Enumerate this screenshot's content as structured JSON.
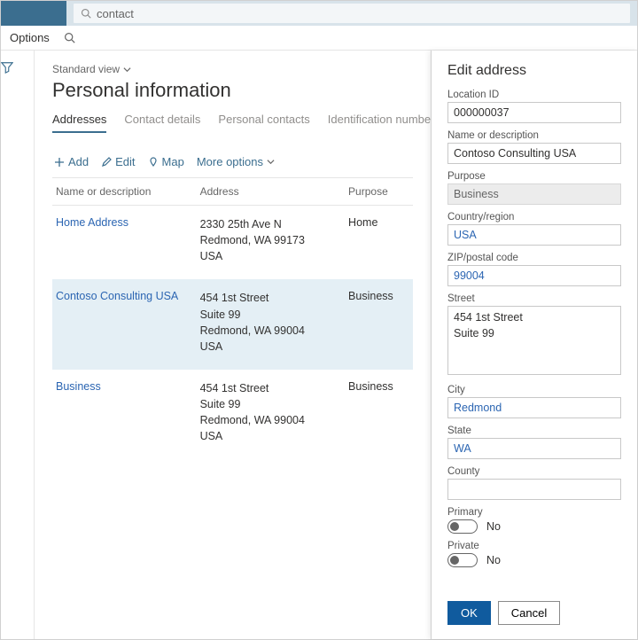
{
  "search": {
    "value": "contact"
  },
  "subbar": {
    "options": "Options"
  },
  "view_label": "Standard view",
  "page_title": "Personal information",
  "tabs": {
    "t0": "Addresses",
    "t1": "Contact details",
    "t2": "Personal contacts",
    "t3": "Identification numbers"
  },
  "toolbar": {
    "add": "Add",
    "edit": "Edit",
    "map": "Map",
    "more": "More options"
  },
  "grid": {
    "h_name": "Name or description",
    "h_addr": "Address",
    "h_purpose": "Purpose",
    "r0": {
      "name": "Home Address",
      "a1": "2330 25th Ave N",
      "a2": "Redmond, WA 99173",
      "a3": "USA",
      "purpose": "Home"
    },
    "r1": {
      "name": "Contoso Consulting USA",
      "a1": "454 1st Street",
      "a2": "Suite 99",
      "a3": "Redmond, WA 99004",
      "a4": "USA",
      "purpose": "Business"
    },
    "r2": {
      "name": "Business",
      "a1": "454 1st Street",
      "a2": "Suite 99",
      "a3": "Redmond, WA 99004",
      "a4": "USA",
      "purpose": "Business"
    }
  },
  "panel": {
    "title": "Edit address",
    "labels": {
      "location_id": "Location ID",
      "name": "Name or description",
      "purpose": "Purpose",
      "country": "Country/region",
      "zip": "ZIP/postal code",
      "street": "Street",
      "city": "City",
      "state": "State",
      "county": "County",
      "primary": "Primary",
      "private": "Private"
    },
    "values": {
      "location_id": "000000037",
      "name": "Contoso Consulting USA",
      "purpose": "Business",
      "country": "USA",
      "zip": "99004",
      "street": "454 1st Street\nSuite 99",
      "city": "Redmond",
      "state": "WA",
      "county": "",
      "primary": "No",
      "private": "No"
    },
    "buttons": {
      "ok": "OK",
      "cancel": "Cancel"
    }
  }
}
